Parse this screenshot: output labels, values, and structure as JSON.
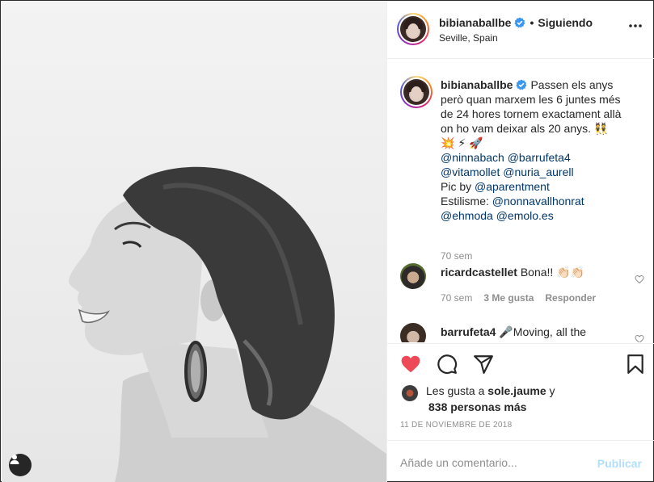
{
  "post": {
    "username": "bibianaballbe",
    "follow_label": "Siguiendo",
    "separator": "•",
    "location": "Seville, Spain"
  },
  "caption": {
    "username": "bibianaballbe",
    "text": "Passen els anys però quan marxem les 6 juntes més de 24 hores tornem exactament allà on ho vam deixar als 20 anys. 👯 💥 ⚡ 🚀",
    "mentions_line1": "@ninnabach @barrufeta4",
    "mentions_line2": "@vitamollet @nuria_aurell",
    "pic_by_label": "Pic by ",
    "pic_by": "@aparentment",
    "styling_label": "Estilisme: ",
    "styling": "@nonnavallhonrat",
    "mentions_line3": "@ehmoda @emolo.es",
    "age": "70 sem"
  },
  "comments": [
    {
      "username": "ricardcastellet",
      "text": "Bona!! 👏🏻👏🏻",
      "age": "70 sem",
      "likes": "3 Me gusta",
      "reply": "Responder"
    },
    {
      "username": "barrufeta4",
      "text": "🎤Moving, all the"
    }
  ],
  "likes": {
    "prefix": "Les gusta a ",
    "user": "sole.jaume",
    "suffix": " y",
    "others": "838 personas más"
  },
  "date": "11 DE NOVIEMBRE DE 2018",
  "add_comment": {
    "placeholder": "Añade un comentario...",
    "publish": "Publicar"
  },
  "icons": {
    "like": "heart-filled-icon",
    "comment": "comment-icon",
    "share": "share-icon",
    "save": "bookmark-icon",
    "more": "more-horizontal-icon",
    "verified": "verified-badge-icon",
    "tagged": "user-tag-icon"
  },
  "colors": {
    "like_red": "#ed4956",
    "verified_blue": "#3897f0",
    "mention_blue": "#00376b",
    "publish_disabled": "#b2dffc",
    "muted_text": "#8e8e8e"
  }
}
